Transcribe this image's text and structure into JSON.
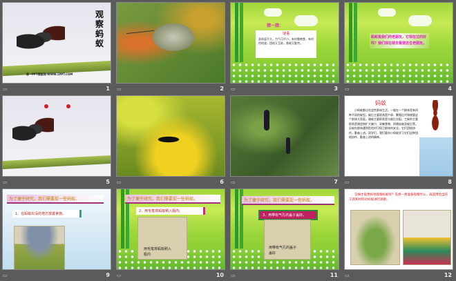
{
  "slides": [
    {
      "num": "1",
      "title": "观察蚂蚁",
      "watermark": "第一PPT模板网-WWW.1PPT.COM"
    },
    {
      "num": "2"
    },
    {
      "num": "3",
      "heading": "猜一猜：",
      "box_title": "谜语",
      "box_text": "身体虽不大，力气可不小，有时搬粮食，有时挖地道，团结又互助，勇敢又勤劳。"
    },
    {
      "num": "4",
      "text": "蚂蚁是我们的老朋友，它现在过的好吗？我们现在就去看望这位老朋友。"
    },
    {
      "num": "5"
    },
    {
      "num": "6"
    },
    {
      "num": "7"
    },
    {
      "num": "8",
      "title": "蚂蚁",
      "text": "小蚂蚁都过社会性群体生活，一般在一个群体里有四种不同的蚁型。蚁后主要职责是产卵、繁殖后代和统管这个群体大家庭。雄蚁主要职责是与蚁后交配。工蚁的主要职责是建造和扩大巢穴、采集食物、饲喂幼蚁及蚁后等。兵蚁在群体遇到危险时可保卫群体的安全。它们团结协作，勤奋上进。同学们，我们要向小蚂蚁学习它们这种团结协作、勤奋上进的精神。"
    },
    {
      "num": "9",
      "banner": "为了便于研究，我们需要捉一些蚂蚁。",
      "step": "1、在蚂蚁出没的地方放置食物。"
    },
    {
      "num": "10",
      "banner": "为了便于研究，我们需要捉一些蚂蚁。",
      "step": "2、用毛笔将蚂蚁刷入瓶内。",
      "caption": "用毛笔将蚂蚁刷入瓶内"
    },
    {
      "num": "11",
      "banner": "为了便于研究，我们需要捉一些蚂蚁。",
      "step": "3、用带有气孔的盖子盖好。",
      "caption": "用带有气孔的盖子盖好"
    },
    {
      "num": "12",
      "text": "怎样才能更好地观察蚂蚁呢？先想一想准备观察什么，再选用恰当的工具和材料对蚂蚁进行观察。"
    }
  ]
}
